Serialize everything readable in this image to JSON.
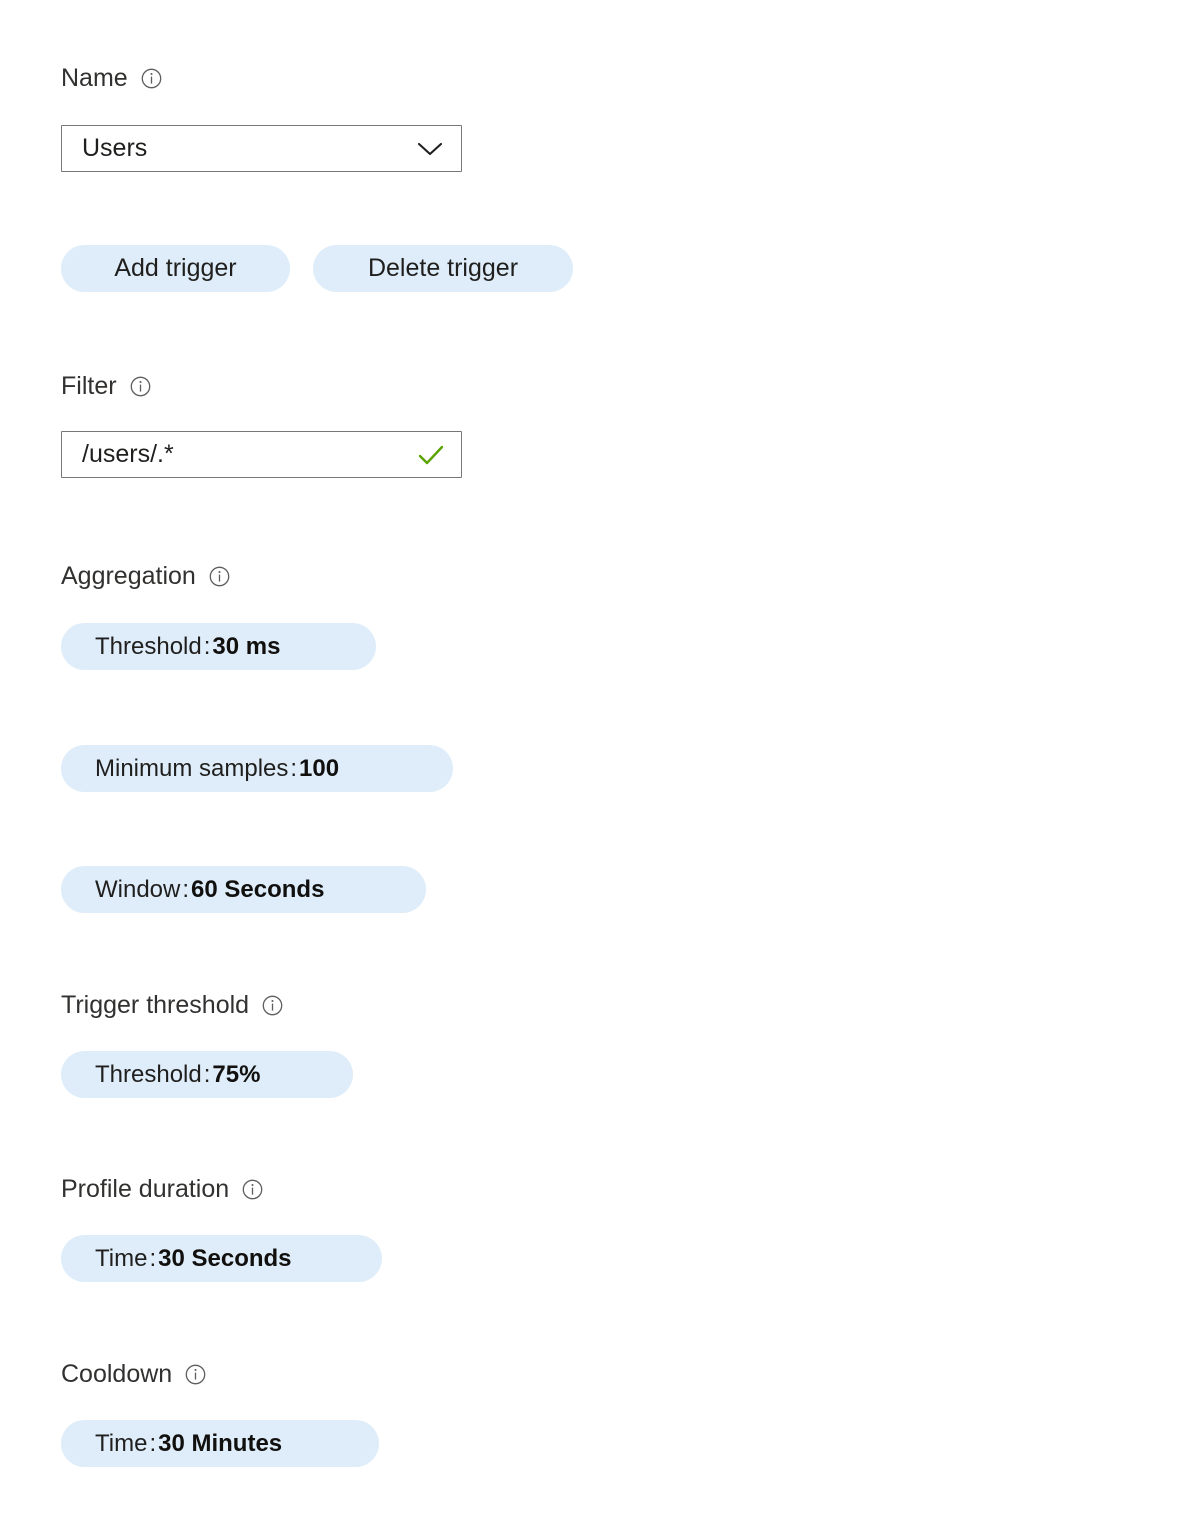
{
  "form": {
    "name_field": {
      "label": "Name",
      "info_icon": "info-circle-icon",
      "value": "Users",
      "chevron_icon": "chevron-down-icon"
    },
    "trigger_actions": {
      "add_label": "Add trigger",
      "delete_label": "Delete trigger"
    },
    "filter_field": {
      "label": "Filter",
      "info_icon": "info-circle-icon",
      "value": "/users/.*",
      "validation_icon": "checkmark-icon",
      "validation_color": "#5BA300"
    },
    "aggregation": {
      "label": "Aggregation",
      "info_icon": "info-circle-icon",
      "items": [
        {
          "label": "Threshold",
          "separator": ":",
          "value": "30 ms"
        },
        {
          "label": "Minimum samples",
          "separator": ":",
          "value": "100"
        },
        {
          "label": "Window",
          "separator": ":",
          "value": "60 Seconds"
        }
      ]
    },
    "trigger_threshold": {
      "label": "Trigger threshold",
      "info_icon": "info-circle-icon",
      "items": [
        {
          "label": "Threshold",
          "separator": ":",
          "value": "75%"
        }
      ]
    },
    "profile_duration": {
      "label": "Profile duration",
      "info_icon": "info-circle-icon",
      "items": [
        {
          "label": "Time",
          "separator": ":",
          "value": "30 Seconds"
        }
      ]
    },
    "cooldown": {
      "label": "Cooldown",
      "info_icon": "info-circle-icon",
      "items": [
        {
          "label": "Time",
          "separator": ":",
          "value": "30 Minutes"
        }
      ]
    }
  },
  "colors": {
    "pill_background": "#DEEDF9",
    "text": "#323130",
    "border": "#797775",
    "success": "#5BA300"
  }
}
